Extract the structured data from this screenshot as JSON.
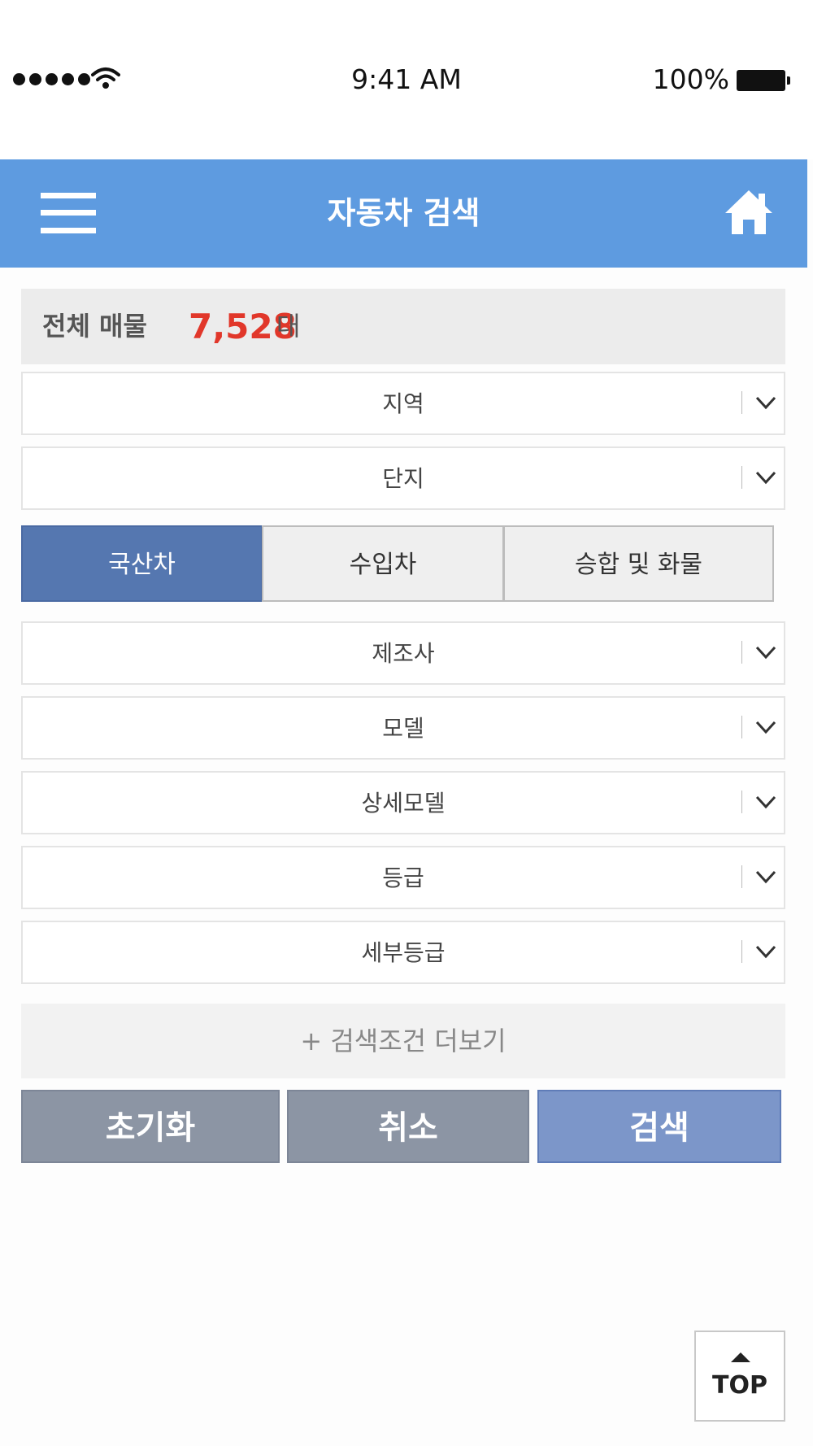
{
  "status_bar": {
    "time": "9:41 AM",
    "battery": "100%",
    "signal_icon": "signal-dots-icon",
    "wifi_icon": "wifi-icon",
    "battery_icon": "battery-icon"
  },
  "header": {
    "title": "자동차 검색",
    "menu_icon": "hamburger-menu-icon",
    "home_icon": "home-icon",
    "background": "#5e9be0"
  },
  "total": {
    "label": "전체 매물",
    "count": "7,528",
    "unit": "대",
    "count_color": "#e1372a"
  },
  "filters_top": [
    {
      "label": "지역"
    },
    {
      "label": "단지"
    }
  ],
  "tabs": [
    {
      "label": "국산차",
      "active": true
    },
    {
      "label": "수입차",
      "active": false
    },
    {
      "label": "승합 및 화물",
      "active": false
    }
  ],
  "filters_bottom": [
    {
      "label": "제조사"
    },
    {
      "label": "모델"
    },
    {
      "label": "상세모델"
    },
    {
      "label": "등급"
    },
    {
      "label": "세부등급"
    }
  ],
  "more_conditions": "+ 검색조건 더보기",
  "actions": {
    "reset": "초기화",
    "cancel": "취소",
    "search": "검색"
  },
  "top_button": "TOP"
}
